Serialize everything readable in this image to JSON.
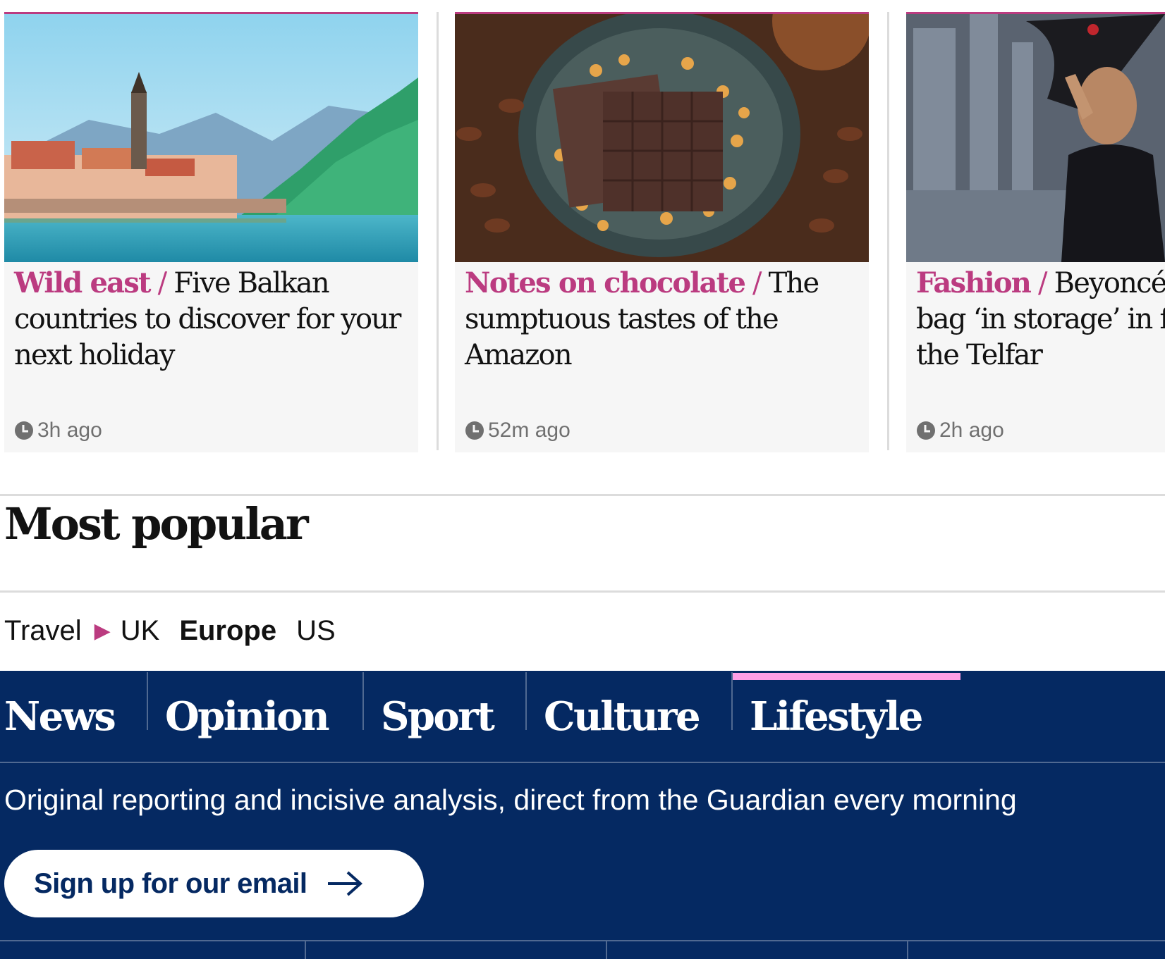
{
  "cards": [
    {
      "kicker": "Wild east",
      "slash": "/",
      "headline": "Five Balkan countries to discover for your next holiday",
      "age": "3h ago"
    },
    {
      "kicker": "Notes on chocolate",
      "slash": "/",
      "headline": "The sumptuous tastes of the Amazon",
      "age": "52m ago"
    },
    {
      "kicker": "Fashion",
      "slash": "/",
      "headline": "Beyoncé’s Birkin bag ‘in storage’ in favour of the Telfar",
      "age": "2h ago"
    }
  ],
  "most_popular": {
    "title": "Most popular",
    "section": "Travel",
    "editions": [
      "UK",
      "Europe",
      "US"
    ],
    "active_edition": "Europe"
  },
  "footer": {
    "pillars": [
      "News",
      "Opinion",
      "Sport",
      "Culture",
      "Lifestyle"
    ],
    "active_pillar": "Lifestyle",
    "tagline": "Original reporting and incisive analysis, direct from the Guardian every morning",
    "signup_label": "Sign up for our email"
  },
  "colors": {
    "lifestyle_accent": "#bb3b80",
    "footer_background": "#052962",
    "lifestyle_highlight": "#ff9fe6"
  },
  "icons": [
    "clock-icon",
    "arrow-right-icon",
    "play-icon"
  ]
}
